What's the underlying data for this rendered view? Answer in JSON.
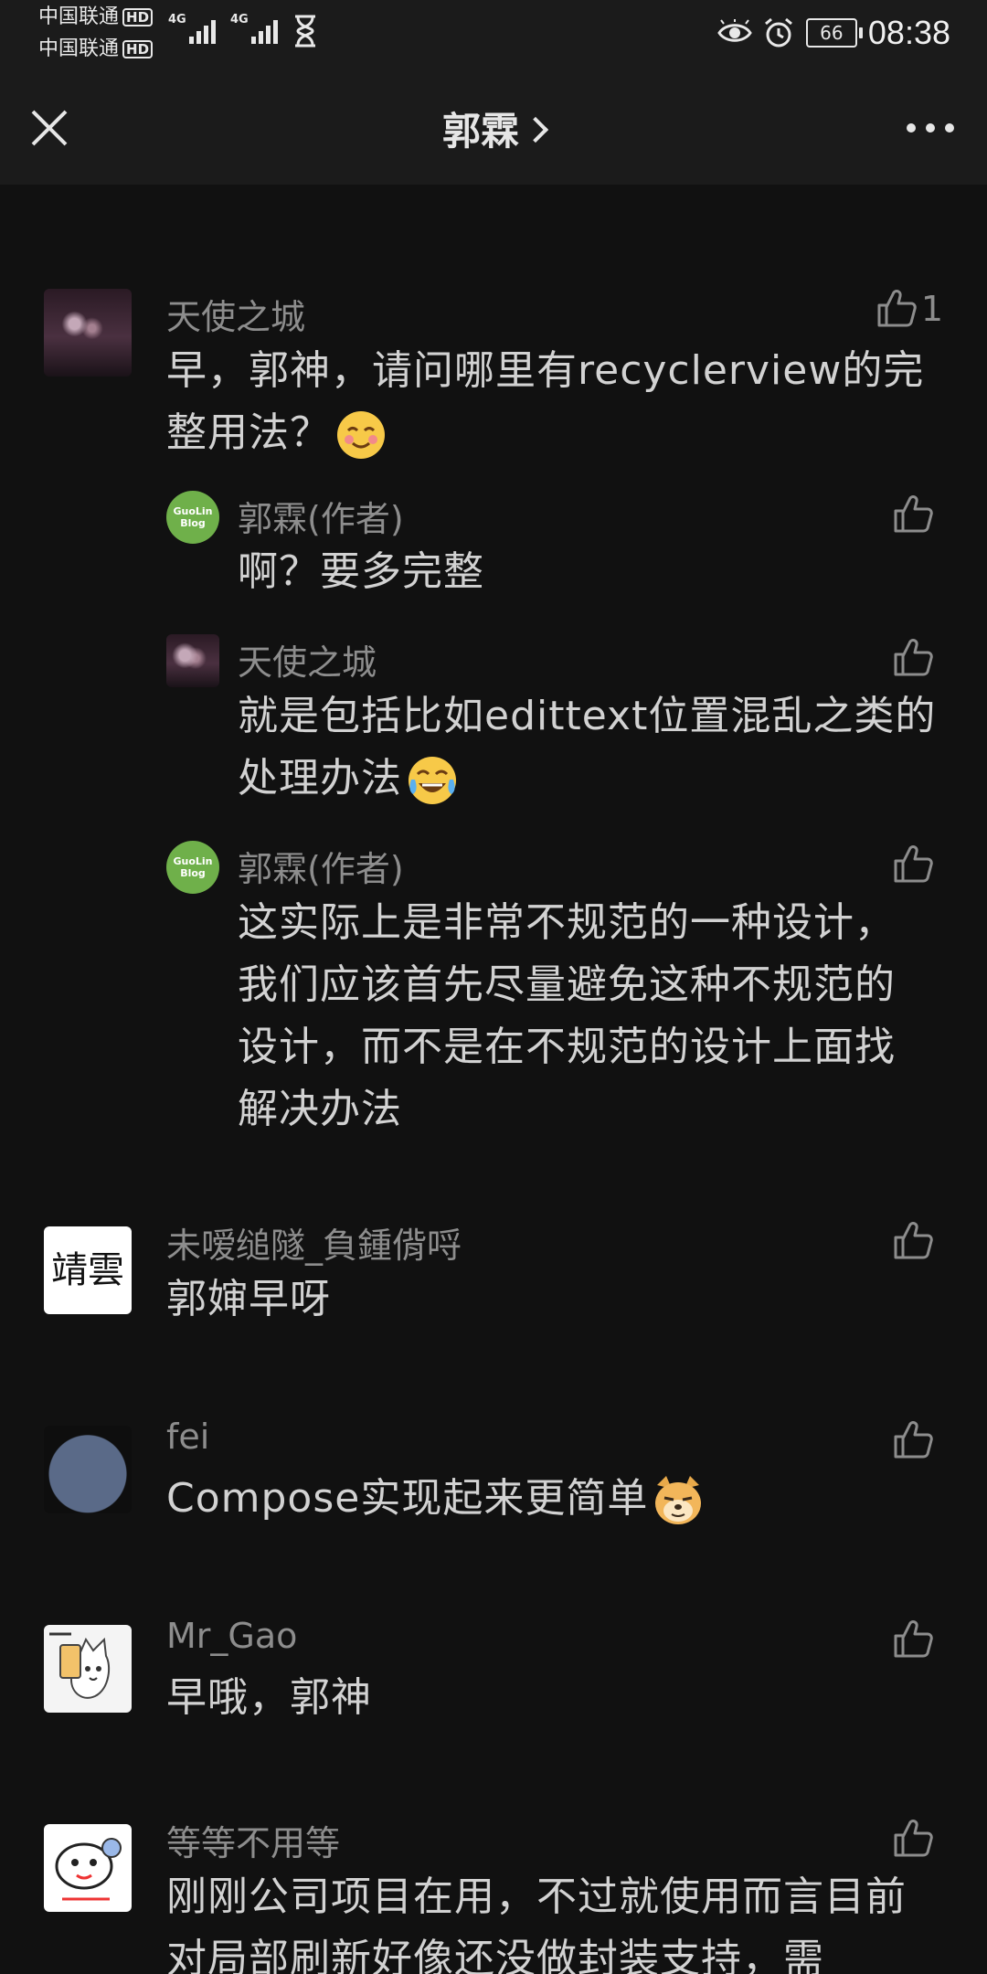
{
  "status_bar": {
    "carrier_1": "中国联通",
    "carrier_2": "中国联通",
    "hd": "HD",
    "net_1": "4G",
    "net_2": "4G",
    "battery": "66",
    "time": "08:38"
  },
  "title_bar": {
    "title": "郭霖"
  },
  "comments": [
    {
      "name": "天使之城",
      "body": "早，郭神，请问哪里有recyclerview的完整用法？",
      "likes": "1",
      "replies": [
        {
          "name": "郭霖(作者)",
          "body": "啊？要多完整"
        },
        {
          "name": "天使之城",
          "body": "就是包括比如edittext位置混乱之类的处理办法"
        },
        {
          "name": "郭霖(作者)",
          "body": "这实际上是非常不规范的一种设计，我们应该首先尽量避免这种不规范的设计，而不是在不规范的设计上面找解决办法"
        }
      ]
    },
    {
      "name": "未嗳缒隧_負鍾偝哷",
      "body": "郭婶早呀"
    },
    {
      "name": "fei",
      "body": "Compose实现起来更简单"
    },
    {
      "name": "Mr_Gao",
      "body": "早哦，郭神"
    },
    {
      "name": "等等不用等",
      "body": "刚刚公司项目在用，不过就使用而言目前对局部刷新好像还没做封装支持，需"
    }
  ],
  "avatar_text": {
    "guolin_1": "GuoLin",
    "guolin_2": "Blog",
    "calligraphy": "靖雲"
  },
  "colors": {
    "background": "#111111",
    "bar": "#1b1b1b",
    "name": "#8d8d8d",
    "body": "#d2d2d2",
    "guolin_green": "#6fb04a"
  }
}
